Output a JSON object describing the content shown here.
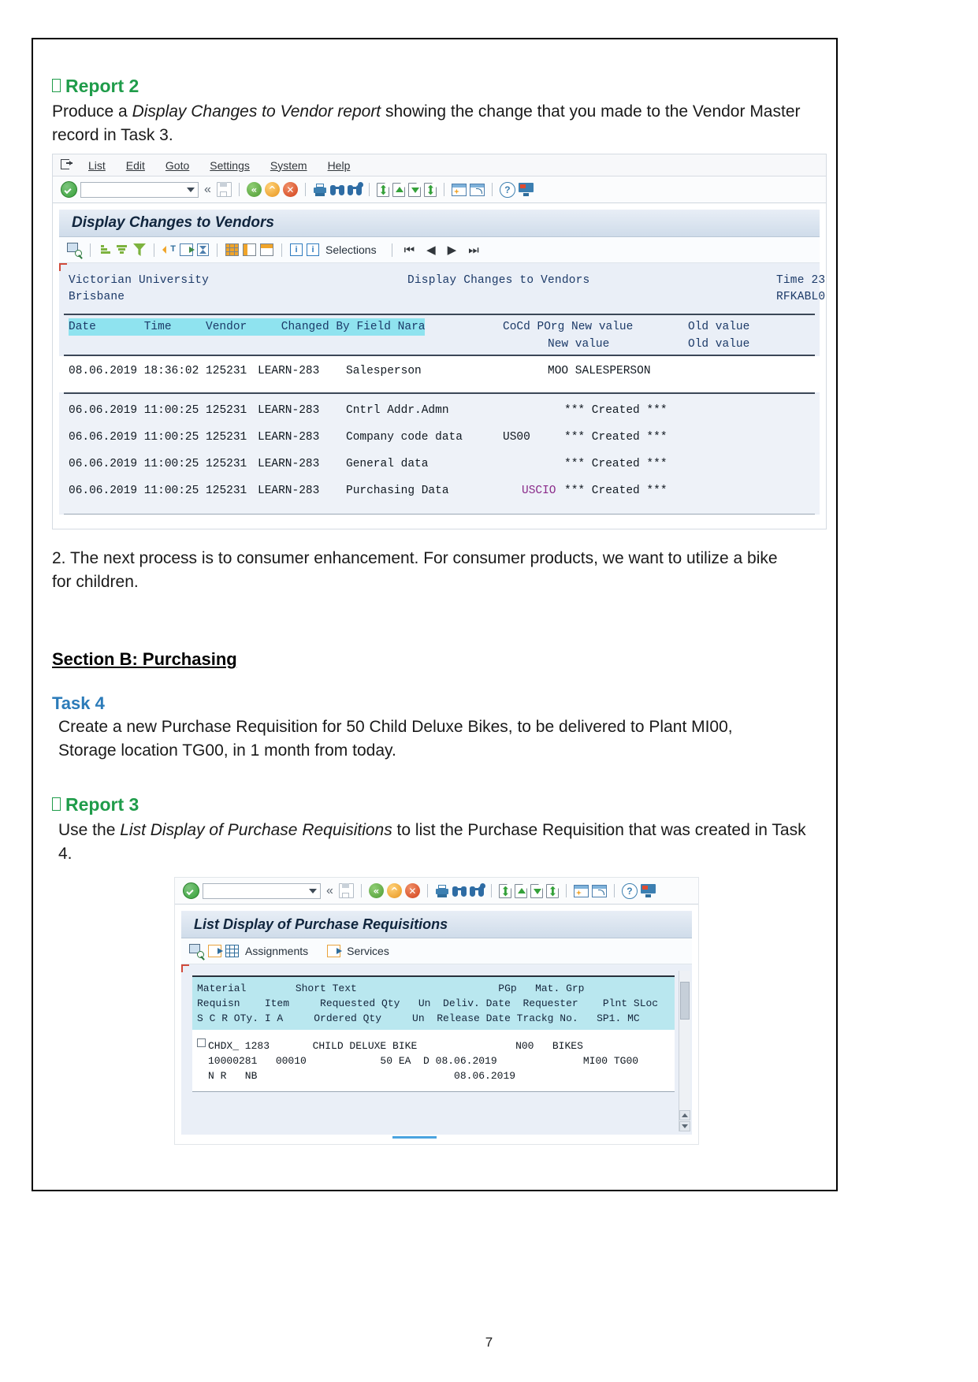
{
  "page": {
    "number": "7"
  },
  "report2": {
    "heading": "Report 2",
    "body_1": "Produce a ",
    "body_italic": "Display Changes to Vendor report",
    "body_2": " showing the change that you made to the Vendor Master record in Task 3."
  },
  "sap1": {
    "menu": [
      "List",
      "Edit",
      "Goto",
      "Settings",
      "System",
      "Help"
    ],
    "command_field_value": "",
    "title": "Display Changes to Vendors",
    "apptoolbar_label_selections": "Selections",
    "report_header": {
      "org_line1": "Victorian University",
      "org_line2": "Brisbane",
      "center_title": "Display Changes to Vendors",
      "right_line1": "Time 23",
      "right_line2": "RFKABL0"
    },
    "columns_line1": "Date       Time     Vendor     Changed By Field Nara",
    "columns_line1_right": "CoCd POrg New value",
    "columns_line1_far": "Old value",
    "columns_line2_right": "New value",
    "columns_line2_far": "Old value",
    "rows": [
      {
        "date": "08.06.2019",
        "time": "18:36:02",
        "vendor": "125231",
        "changed_by": "LEARN-283",
        "field_name": "Salesperson",
        "cocd": "",
        "new_value": "MOO SALESPERSON"
      },
      {
        "date": "06.06.2019",
        "time": "11:00:25",
        "vendor": "125231",
        "changed_by": "LEARN-283",
        "field_name": "Cntrl Addr.Admn",
        "cocd": "",
        "new_value": "*** Created ***"
      },
      {
        "date": "06.06.2019",
        "time": "11:00:25",
        "vendor": "125231",
        "changed_by": "LEARN-283",
        "field_name": "Company code data",
        "cocd": "US00",
        "new_value": "*** Created ***"
      },
      {
        "date": "06.06.2019",
        "time": "11:00:25",
        "vendor": "125231",
        "changed_by": "LEARN-283",
        "field_name": "General data",
        "cocd": "",
        "new_value": "*** Created ***"
      },
      {
        "date": "06.06.2019",
        "time": "11:00:25",
        "vendor": "125231",
        "changed_by": "LEARN-283",
        "field_name": "Purchasing Data",
        "cocd": "USCIO",
        "new_value": "*** Created ***"
      }
    ]
  },
  "para2": "2. The next process is to consumer enhancement. For consumer products, we want to utilize a bike for children.",
  "sectionB": {
    "heading": "Section B: Purchasing"
  },
  "task4": {
    "heading": "Task 4",
    "body": "Create a new Purchase Requisition for 50 Child Deluxe Bikes, to be delivered to Plant MI00, Storage location TG00, in 1 month from today."
  },
  "report3": {
    "heading": "Report 3",
    "body_1": "Use the ",
    "body_italic": "List Display of Purchase Requisitions",
    "body_2": " to list the Purchase Requisition that was created in Task 4."
  },
  "sap2": {
    "command_field_value": "",
    "title": "List Display of Purchase Requisitions",
    "toolbar_labels": {
      "assignments": "Assignments",
      "services": "Services"
    },
    "columns_line1": "Material        Short Text                       PGp   Mat. Grp",
    "columns_line2": "Requisn    Item     Requested Qty   Un  Deliv. Date  Requester    Plnt SLoc",
    "columns_line3": "S C R OTy. I A     Ordered Qty     Un  Release Date Trackg No.   SP1. MC",
    "row_line1": "CHDX_ 1283       CHILD DELUXE BIKE                N00   BIKES",
    "row_line2": "10000281   00010            50 EA  D 08.06.2019              MI00 TG00",
    "row_line3": "N R   NB                                08.06.2019"
  }
}
